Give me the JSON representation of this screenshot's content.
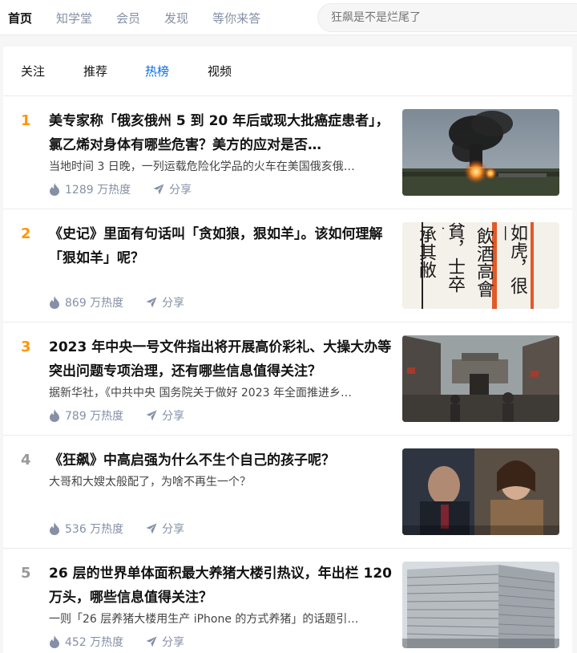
{
  "topnav": {
    "items": [
      "首页",
      "知学堂",
      "会员",
      "发现",
      "等你来答"
    ]
  },
  "search": {
    "placeholder": "狂飙是不是烂尾了"
  },
  "tabs": [
    "关注",
    "推荐",
    "热榜",
    "视频"
  ],
  "hot_list": [
    {
      "rank": "1",
      "title": "美专家称「俄亥俄州 5 到 20 年后或现大批癌症患者」，氯乙烯对身体有哪些危害？美方的应对是否…",
      "excerpt": "当地时间 3 日晚，一列运载危险化学品的火车在美国俄亥俄…",
      "heat": "1289 万热度",
      "share": "分享"
    },
    {
      "rank": "2",
      "title": "《史记》里面有句话叫「贪如狼，狠如羊」。该如何理解「狠如羊」呢？",
      "excerpt": "",
      "heat": "869 万热度",
      "share": "分享",
      "thumb_text": [
        "如虎，很如",
        "飲酒高會",
        "貧，士卒食",
        "承其敝"
      ]
    },
    {
      "rank": "3",
      "title": "2023 年中央一号文件指出将开展高价彩礼、大操大办等突出问题专项治理，还有哪些信息值得关注？",
      "excerpt": "据新华社，《中共中央 国务院关于做好 2023 年全面推进乡…",
      "heat": "789 万热度",
      "share": "分享"
    },
    {
      "rank": "4",
      "title": "《狂飙》中高启强为什么不生个自己的孩子呢？",
      "excerpt": "大哥和大嫂太般配了，为啥不再生一个？",
      "heat": "536 万热度",
      "share": "分享"
    },
    {
      "rank": "5",
      "title": "26 层的世界单体面积最大养猪大楼引热议，年出栏 120 万头，哪些信息值得关注？",
      "excerpt": "一则「26 层养猪大楼用生产 iPhone 的方式养猪」的话题引…",
      "heat": "452 万热度",
      "share": "分享"
    }
  ],
  "colors": {
    "accent": "#056de8",
    "rank_top": "#ff9607",
    "rank_rest": "#999999",
    "meta": "#8590a6"
  }
}
